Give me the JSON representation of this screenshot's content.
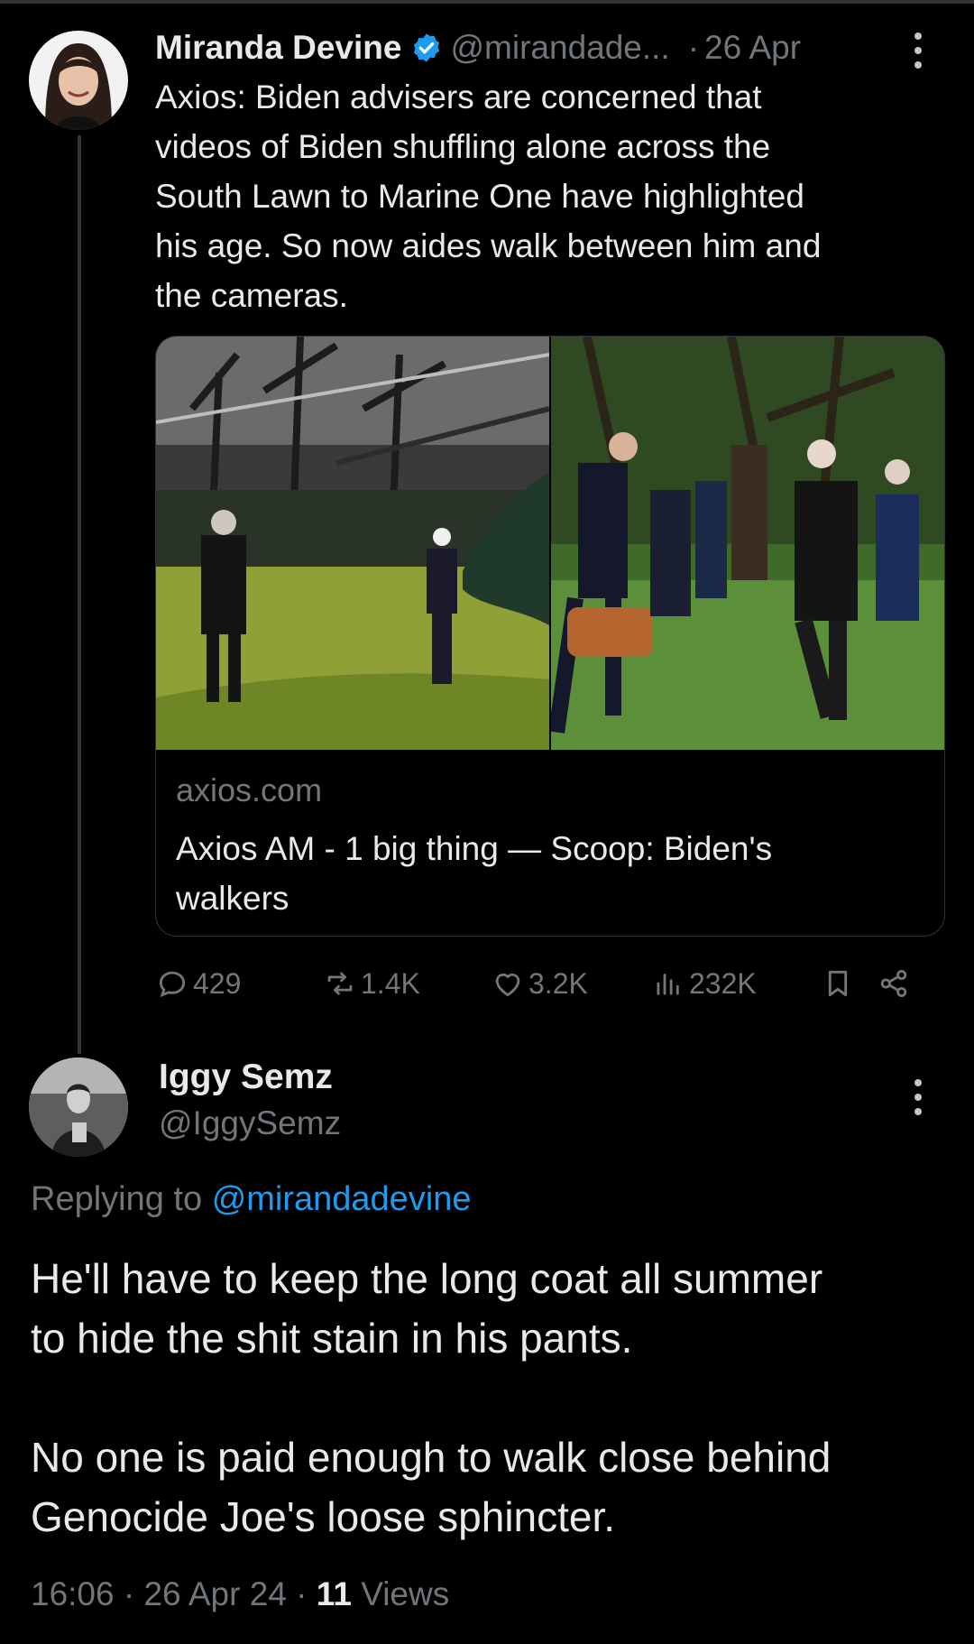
{
  "original_tweet": {
    "author_name": "Miranda Devine",
    "handle": "@mirandade...",
    "separator": "·",
    "date": "26 Apr",
    "text_lines": [
      "Axios: Biden advisers are concerned that",
      "videos of Biden shuffling alone across the",
      "South Lawn to Marine One have highlighted",
      "his age. So now aides walk between him and",
      "the cameras."
    ],
    "link_card": {
      "domain": "axios.com",
      "title_lines": [
        "Axios AM - 1 big thing — Scoop: Biden's",
        "walkers"
      ]
    },
    "metrics": {
      "replies": "429",
      "reposts": "1.4K",
      "likes": "3.2K",
      "views": "232K"
    }
  },
  "reply": {
    "author_name": "Iggy Semz",
    "handle": "@IggySemz",
    "replying_prefix": "Replying to",
    "replying_to": "@mirandadevine",
    "text_lines": [
      "He'll have to keep the long coat all summer",
      "to hide the shit stain in his pants.",
      "",
      "No one is paid enough to walk close behind",
      "Genocide Joe's loose sphincter."
    ],
    "time": "16:06",
    "date": "26 Apr 24",
    "views_count": "11",
    "views_label": "Views"
  },
  "icons": {
    "verified": "verified-badge-icon",
    "more": "more-vertical-icon",
    "reply": "comment-icon",
    "repost": "repost-icon",
    "like": "heart-icon",
    "views": "analytics-icon",
    "bookmark": "bookmark-icon",
    "share": "share-icon"
  },
  "colors": {
    "background": "#000000",
    "text": "#e7e9ea",
    "muted": "#71767b",
    "link": "#1d9bf0",
    "verified": "#1d9bf0"
  }
}
